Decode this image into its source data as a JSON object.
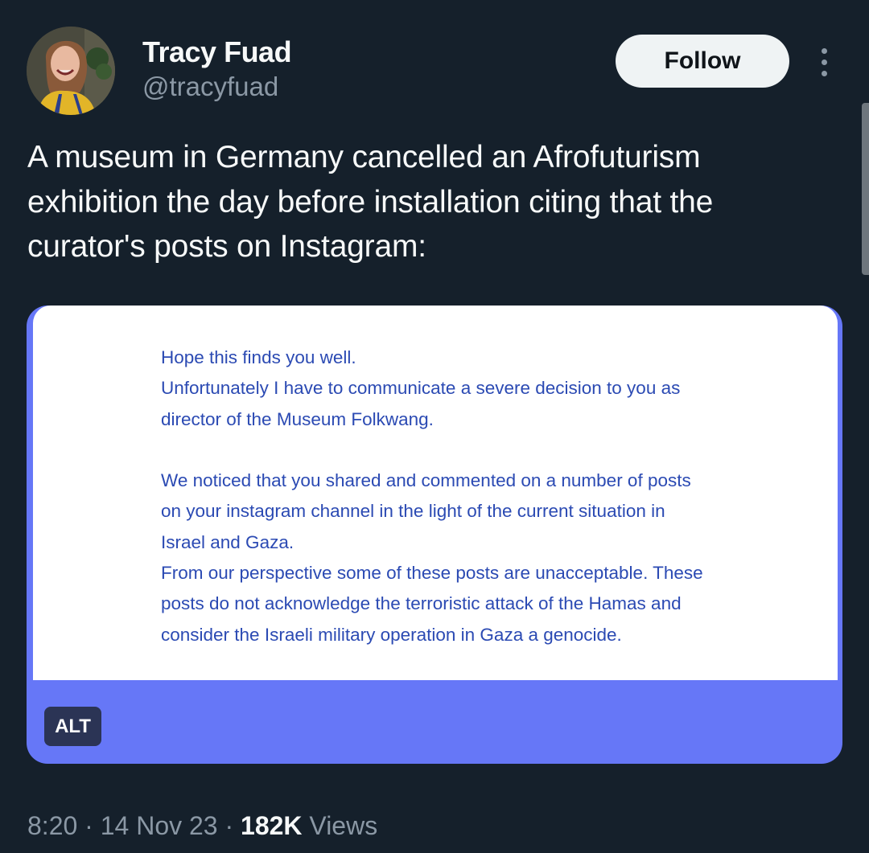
{
  "author": {
    "name": "Tracy Fuad",
    "handle": "@tracyfuad",
    "avatar_icon": "profile-photo"
  },
  "actions": {
    "follow_label": "Follow",
    "more_icon": "more-vertical-icon"
  },
  "tweet": {
    "text": "A museum in Germany cancelled an Afrofuturism\nexhibition the day before installation citing that the\ncurator's posts on Instagram:"
  },
  "media": {
    "letter_text": "Hope this finds you well.\nUnfortunately I have to communicate a severe decision to you as\ndirector of the Museum Folkwang.\n\nWe noticed that you shared and commented on a number of posts\non your instagram channel in the light of the current situation in\nIsrael and Gaza.\nFrom our perspective some of these posts are unacceptable. These\nposts do not acknowledge the terroristic attack of the Hamas and\nconsider the Israeli military operation in Gaza a genocide.",
    "alt_label": "ALT"
  },
  "meta": {
    "time": "8:20",
    "separator": "·",
    "date": "14 Nov 23",
    "views_count": "182K",
    "views_label": "Views"
  },
  "colors": {
    "background": "#15202b",
    "media_border": "#6677f7",
    "letter_text": "#2b4ab3",
    "secondary_text": "#8b98a5"
  }
}
